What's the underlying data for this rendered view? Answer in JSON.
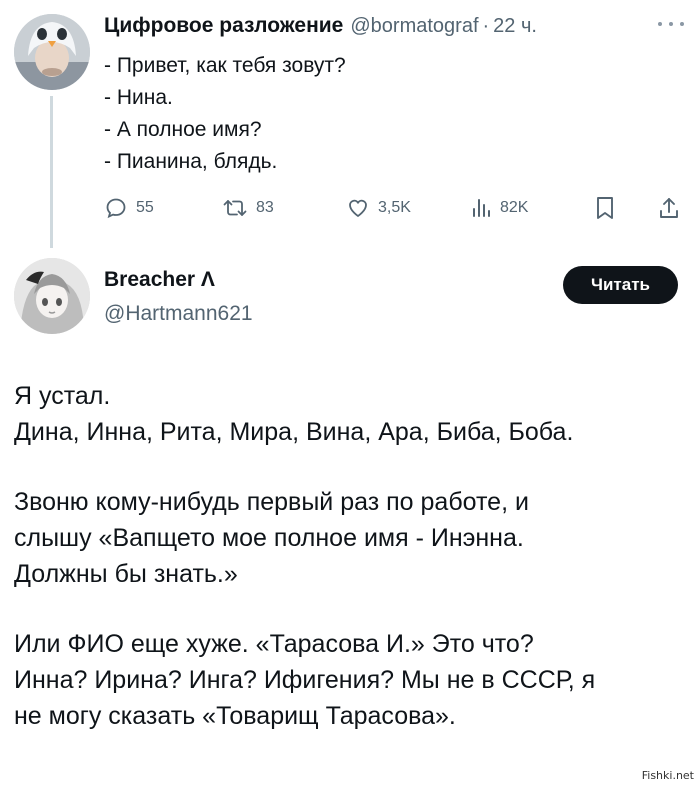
{
  "tweet1": {
    "author_name": "Цифровое разложение",
    "handle": "@bormatograf",
    "separator": "·",
    "time": "22 ч.",
    "avatar_icon": "user-avatar-penguin-hat",
    "lines": [
      "- Привет, как тебя зовут?",
      "- Нина.",
      "- А полное имя?",
      "- Пианинa, блядь."
    ],
    "actions": {
      "replies": "55",
      "retweets": "83",
      "likes": "3,5K",
      "views": "82K"
    }
  },
  "tweet2": {
    "author_name": "Breacher Λ",
    "handle": "@Hartmann621",
    "follow_label": "Читать",
    "avatar_icon": "user-avatar-anime",
    "lines": [
      "Я устал.",
      "Дина, Инна, Рита, Мира, Вина, Ара, Биба, Боба.",
      "",
      "Звоню кому-нибудь первый раз по работе, и",
      "слышу «Вапщето мое полное имя - Инэнна.",
      "Должны бы знать.»",
      "",
      "Или ФИО еще хуже. «Тарасова И.» Это что?",
      "Инна? Ирина? Инга? Ифигения? Мы не в СССР, я",
      "не могу сказать «Товарищ Тарасова»."
    ]
  },
  "watermark": "Fishki.net",
  "colors": {
    "text": "#0f1419",
    "secondary": "#536471",
    "thread_line": "#cfd9de",
    "button_bg": "#0f1419",
    "button_text": "#ffffff"
  }
}
